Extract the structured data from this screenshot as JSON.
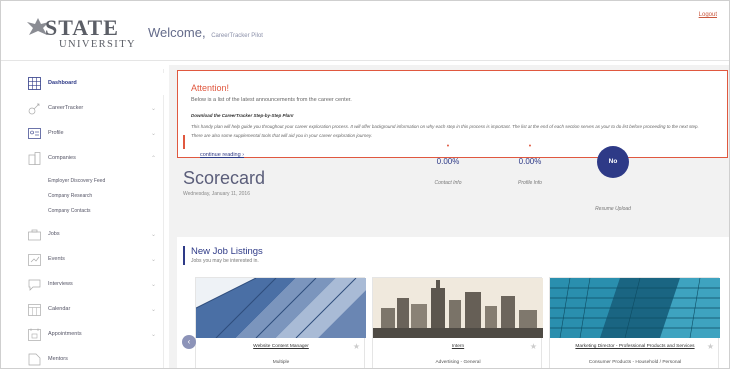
{
  "header": {
    "logo_top": "STATE",
    "logo_bottom": "UNIVERSITY",
    "welcome": "Welcome,",
    "welcome_name": "CareerTracker Pilot",
    "logout": "Logout"
  },
  "sidebar": {
    "items": [
      {
        "label": "Dashboard",
        "icon": "dashboard-icon",
        "has_chevron": false
      },
      {
        "label": "CareerTracker",
        "icon": "career-tracker-icon",
        "has_chevron": true
      },
      {
        "label": "Profile",
        "icon": "profile-icon",
        "has_chevron": true
      },
      {
        "label": "Companies",
        "icon": "companies-icon",
        "has_chevron": true
      },
      {
        "label": "Jobs",
        "icon": "jobs-icon",
        "has_chevron": true
      },
      {
        "label": "Events",
        "icon": "events-icon",
        "has_chevron": true
      },
      {
        "label": "Interviews",
        "icon": "interviews-icon",
        "has_chevron": true
      },
      {
        "label": "Calendar",
        "icon": "calendar-icon",
        "has_chevron": true
      },
      {
        "label": "Appointments",
        "icon": "appointments-icon",
        "has_chevron": true
      },
      {
        "label": "Mentors",
        "icon": "mentors-icon",
        "has_chevron": false
      }
    ],
    "companies_sub": [
      "Employer Discovery Feed",
      "Company Research",
      "Company Contacts"
    ]
  },
  "attention": {
    "title": "Attention!",
    "subtitle": "Below is a list of the latest announcements from the career center.",
    "bold_line": "Download the CareerTracker Step-by-Step Plan!",
    "body": "This handy plan will help guide you throughout your career exploration process. It will offer background information on why each step in this process is important. The list at the end of each section serves as your to do list before proceeding to the next step. There are also some supplemental tools that will aid you in your career exploration journey.",
    "link": "continue reading ›"
  },
  "scorecard": {
    "title": "Scorecard",
    "date": "Wednesday, January 11, 2016",
    "stats": [
      {
        "value": "0.00%",
        "label": "Contact Info"
      },
      {
        "value": "0.00%",
        "label": "Profile Info"
      }
    ],
    "resume_badge": "No",
    "resume_label": "Resume Upload"
  },
  "jobs": {
    "title": "New Job Listings",
    "subtitle": "Jobs you may be interested in.",
    "prev_icon": "chevron-left-icon",
    "cards": [
      {
        "title": "Website Content Manager",
        "category": "Multiple"
      },
      {
        "title": "Intern",
        "category": "Advertising - General"
      },
      {
        "title": "Marketing Director - Professional Products and Services",
        "category": "Consumer Products - Household / Personal"
      }
    ]
  },
  "colors": {
    "accent_orange": "#e0583f",
    "navy": "#2e3a87"
  }
}
